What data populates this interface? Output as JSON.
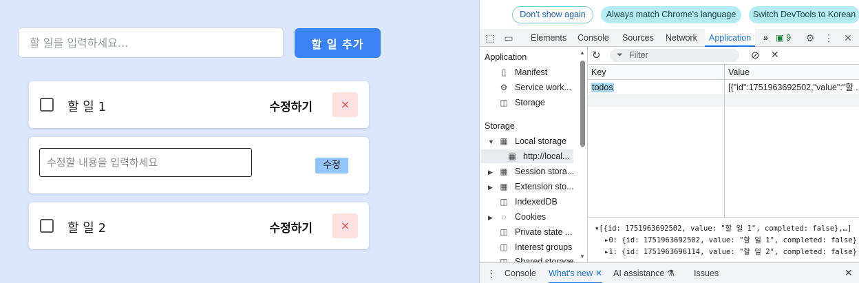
{
  "app": {
    "input_placeholder": "할 일을 입력하세요...",
    "add_button": "할 일 추가",
    "todos": [
      {
        "text": "할 일 1",
        "edit_label": "수정하기",
        "delete_label": "×"
      },
      {
        "text": "할 일 2",
        "edit_label": "수정하기",
        "delete_label": "×"
      }
    ],
    "editing": {
      "placeholder": "수정할 내용을 입력하세요",
      "confirm_label": "수정"
    }
  },
  "devtools": {
    "infobar": {
      "dont_show": "Don't show again",
      "match_language": "Always match Chrome's language",
      "switch_language": "Switch DevTools to Korean"
    },
    "tabs": [
      "Elements",
      "Console",
      "Sources",
      "Network",
      "Application"
    ],
    "more_tabs": "»",
    "issues_badge": "9",
    "sidebar": {
      "application_heading": "Application",
      "application_items": [
        "Manifest",
        "Service work...",
        "Storage"
      ],
      "storage_heading": "Storage",
      "storage_items": [
        "Local storage",
        "http://local...",
        "Session stora...",
        "Extension sto...",
        "IndexedDB",
        "Cookies",
        "Private state ...",
        "Interest groups",
        "Shared storage"
      ]
    },
    "filter_placeholder": "Filter",
    "table": {
      "headers": [
        "Key",
        "Value"
      ],
      "rows": [
        {
          "key": "todos",
          "value": "[{\"id\":1751963692502,\"value\":\"할 ..."
        }
      ]
    },
    "console_lines": [
      "▾[{id: 1751963692502, value: \"할 일 1\", completed: false},…]",
      "▸0: {id: 1751963692502, value: \"할 일 1\", completed: false}",
      "▸1: {id: 1751963696114, value: \"할 일 2\", completed: false}"
    ],
    "drawer_tabs": [
      "Console",
      "What's new",
      "AI assistance",
      "Issues"
    ]
  }
}
